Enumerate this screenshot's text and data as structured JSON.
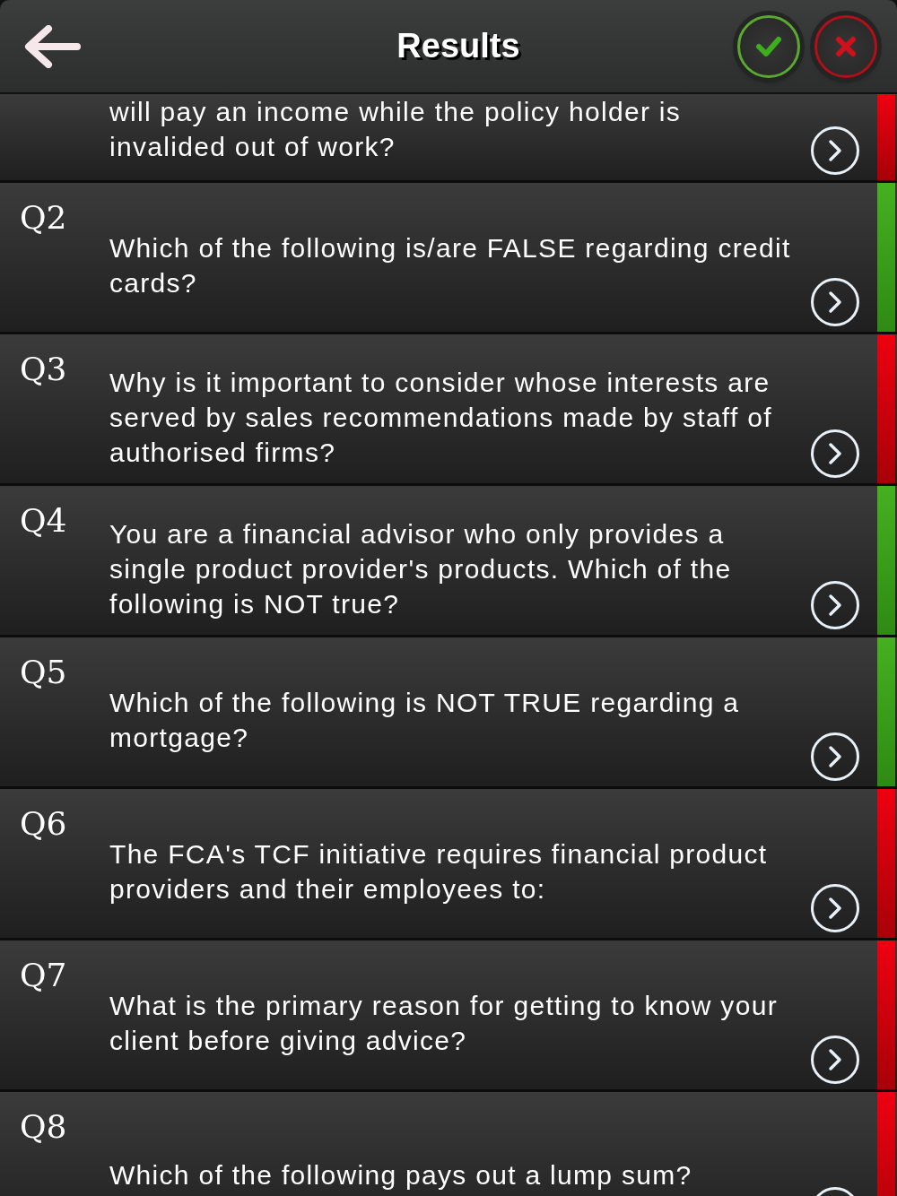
{
  "header": {
    "title": "Results"
  },
  "questions": [
    {
      "text": "will pay an income while the policy holder is invalided out of work?",
      "correct": false,
      "partial": true
    },
    {
      "number": "Q2",
      "text": "Which of the following is/are FALSE regarding credit cards?",
      "correct": true
    },
    {
      "number": "Q3",
      "text": "Why is it important to consider whose interests are served by sales recommendations made by staff of authorised firms?",
      "correct": false
    },
    {
      "number": "Q4",
      "text": "You are a financial advisor who only provides a single product provider's products. Which of the following is NOT true?",
      "correct": true
    },
    {
      "number": "Q5",
      "text": "Which of the following is NOT TRUE regarding a mortgage?",
      "correct": true
    },
    {
      "number": "Q6",
      "text": "The FCA's TCF initiative requires financial product providers and their employees to:",
      "correct": false
    },
    {
      "number": "Q7",
      "text": "What is the primary reason for getting to know your client before giving advice?",
      "correct": false
    },
    {
      "number": "Q8",
      "text": "Which of the following pays out a lump sum?",
      "correct": false
    }
  ]
}
